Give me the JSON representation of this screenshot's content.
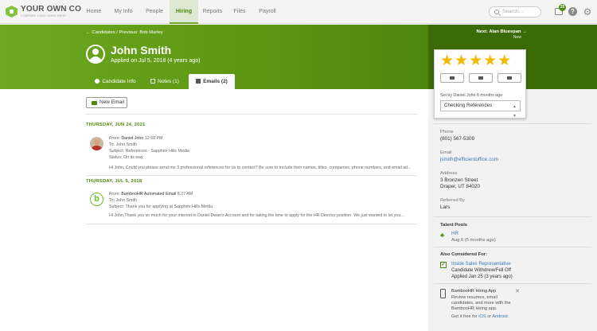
{
  "topnav": {
    "logo_title": "YOUR OWN CO",
    "logo_sub": "COMPANY LOGO GOES HERE",
    "items": [
      "Home",
      "My Info",
      "People",
      "Hiring",
      "Reports",
      "Files",
      "Payroll"
    ],
    "active": "Hiring",
    "search_placeholder": "Search...",
    "inbox_count": "20",
    "accent": "#6fa82a"
  },
  "hero": {
    "breadcrumb": "← Candidates / Previous: Bob Marley",
    "next_link": "Next: Alan Bluespan →",
    "next_sub": "New",
    "name": "John Smith",
    "applied": "Applied on Jul 5, 2018 (4 years ago)",
    "tabs": [
      "Candidate Info",
      "Notes (1)",
      "Emails (2)"
    ],
    "active_tab": "Emails (2)"
  },
  "main": {
    "new_email_label": "New Email",
    "groups": [
      {
        "date": "THURSDAY, JUN 24, 2021",
        "from_label": "From:",
        "from": "Daniel John",
        "time": "12:58 PM",
        "to": "To:  John Smith",
        "subject": "Subject:  References - Sapphire Hills Media",
        "status": "Status:  On its way",
        "preview": "Hi John, Could you please send me 3 professional references for us to contact? Be sure to include their names, titles, companies, phone numbers, and email ad..."
      },
      {
        "date": "THURSDAY, JUL 5, 2018",
        "from_label": "From:",
        "from": "BambooHR Automated Email",
        "time": "8:27 AM",
        "to": "To:  John Smith",
        "subject": "Subject:  Thank you for applying at Sapphire Hills Media",
        "preview": "Hi John,Thank you so much for your interest in Daniel Dwan's Account and for taking the time to apply for the HR Director position. We just wanted to let you..."
      }
    ]
  },
  "sidebar": {
    "stars": "★★★★★",
    "set_by": "Set by Daniel John 6 months ago",
    "status_select": "Checking References",
    "phone_label": "Phone",
    "phone": "(801) 567-5309",
    "email_label": "Email",
    "email": "jsmith@efficientoffice.com",
    "address_label": "Address",
    "address_line1": "3 Bronzen Street",
    "address_line2": "Draper, UT 84020",
    "referred_label": "Referred By",
    "referred": "Lars",
    "talent_pools_label": "Talent Pools",
    "pool_name": "HR",
    "pool_date": "Aug 6 (5 months ago)",
    "also_label": "Also Considered For:",
    "also_job": "Inside Sales Representative",
    "also_status": "Candidate Withdrew/Fell Off",
    "also_date": "Applied Jan 25 (3 years ago)",
    "app_title": "BambooHR Hiring App",
    "app_desc1": "Review resumes, email",
    "app_desc2": "candidates, and more with the",
    "app_desc3": "BambooHR Hiring app.",
    "app_get": "Get it free for",
    "app_ios": "iOS",
    "app_or": "or",
    "app_android": "Android."
  }
}
